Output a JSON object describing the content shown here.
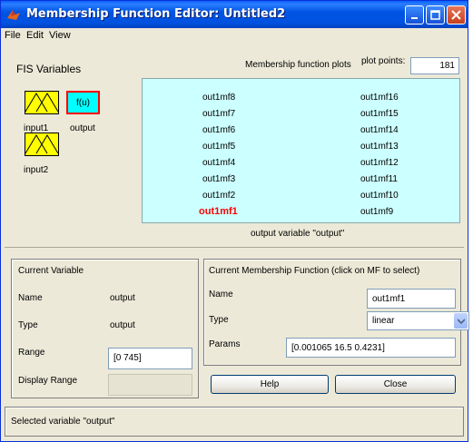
{
  "window": {
    "title": "Membership Function Editor: Untitled2"
  },
  "menu": [
    "File",
    "Edit",
    "View"
  ],
  "fis": {
    "heading": "FIS Variables",
    "input1": "input1",
    "input2": "input2",
    "output": "output",
    "output_icon_text": "f(u)"
  },
  "plot": {
    "label": "Membership function plots",
    "points_label": "plot points:",
    "points_value": "181",
    "left_column": [
      "out1mf8",
      "out1mf7",
      "out1mf6",
      "out1mf5",
      "out1mf4",
      "out1mf3",
      "out1mf2",
      "out1mf1"
    ],
    "right_column": [
      "out1mf16",
      "out1mf15",
      "out1mf14",
      "out1mf13",
      "out1mf12",
      "out1mf11",
      "out1mf10",
      "out1mf9"
    ],
    "selected": "out1mf1",
    "caption": "output variable \"output\""
  },
  "current_variable": {
    "heading": "Current Variable",
    "name_label": "Name",
    "name_value": "output",
    "type_label": "Type",
    "type_value": "output",
    "range_label": "Range",
    "range_value": "[0 745]",
    "display_range_label": "Display Range",
    "display_range_value": ""
  },
  "current_mf": {
    "heading": "Current Membership Function (click on MF to select)",
    "name_label": "Name",
    "name_value": "out1mf1",
    "type_label": "Type",
    "type_value": "linear",
    "params_label": "Params",
    "params_value": "[0.001065 16.5 0.4231]"
  },
  "buttons": {
    "help": "Help",
    "close": "Close"
  },
  "status": "Selected variable \"output\"",
  "colors": {
    "plot_bg": "#ccffff",
    "selected_mf": "#ff0000",
    "mf_icon": "#ffff00",
    "output_icon": "#00ffff",
    "titlebar": "#0054e3"
  }
}
